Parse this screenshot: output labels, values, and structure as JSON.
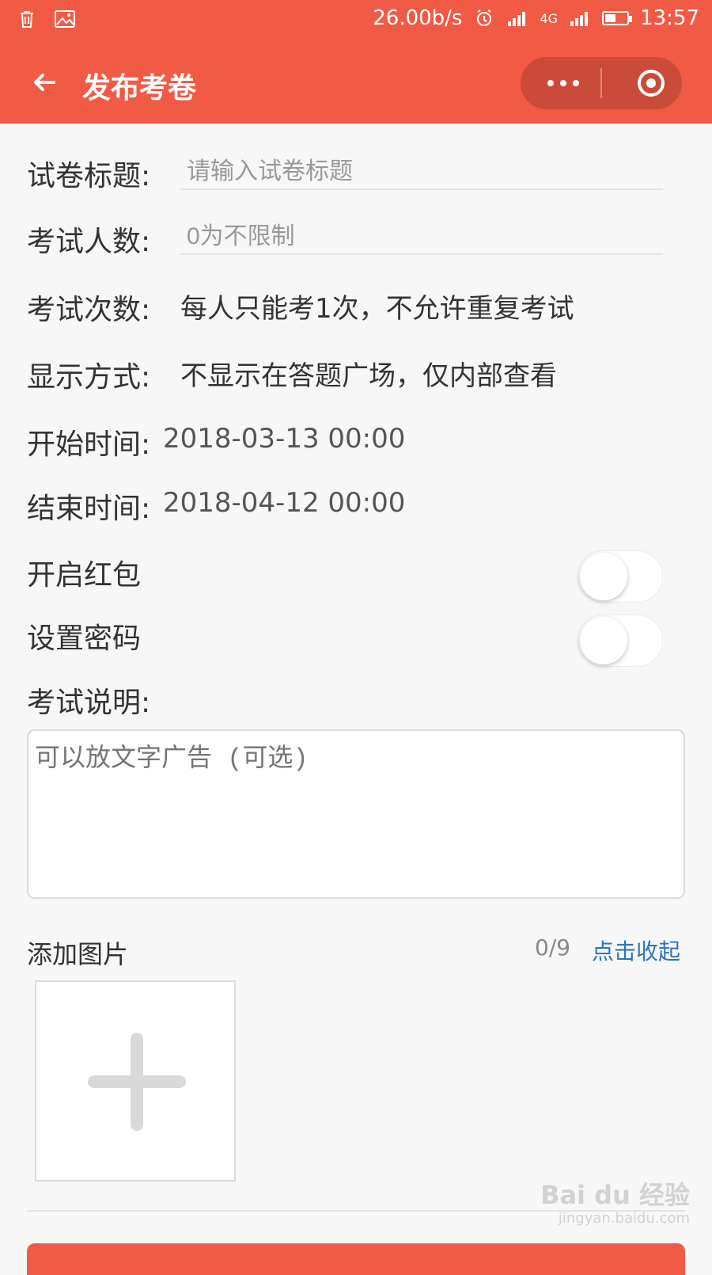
{
  "status": {
    "network_speed": "26.00b/s",
    "network_type": "4G",
    "battery_percent": 50,
    "time": "13:57",
    "left_icons": [
      "trash-icon",
      "image-icon"
    ],
    "right_icons": [
      "alarm-icon",
      "signal-icon",
      "signal-icon-2",
      "battery-icon"
    ]
  },
  "nav": {
    "title": "发布考卷",
    "back_icon": "back-arrow-icon",
    "more_icon": "more-dots-icon",
    "close_icon": "target-circle-icon"
  },
  "form": {
    "title_label": "试卷标题:",
    "title_placeholder": "请输入试卷标题",
    "people_label": "考试人数:",
    "people_placeholder": "0为不限制",
    "attempts_label": "考试次数:",
    "attempts_value": "每人只能考1次，不允许重复考试",
    "display_label": "显示方式:",
    "display_value": "不显示在答题广场，仅内部查看",
    "start_label": "开始时间:",
    "start_value": "2018-03-13  00:00",
    "end_label": "结束时间:",
    "end_value": "2018-04-12  00:00",
    "redpacket_label": "开启红包",
    "password_label": "设置密码",
    "desc_label": "考试说明:",
    "desc_placeholder": "可以放文字广告 (可选)",
    "add_image_label": "添加图片",
    "image_count": "0/9",
    "collapse_label": "点击收起"
  },
  "watermark": {
    "logo": "Bai du 经验",
    "url": "jingyan.baidu.com"
  },
  "colors": {
    "brand": "#f15a44",
    "link": "#2b76b9"
  }
}
